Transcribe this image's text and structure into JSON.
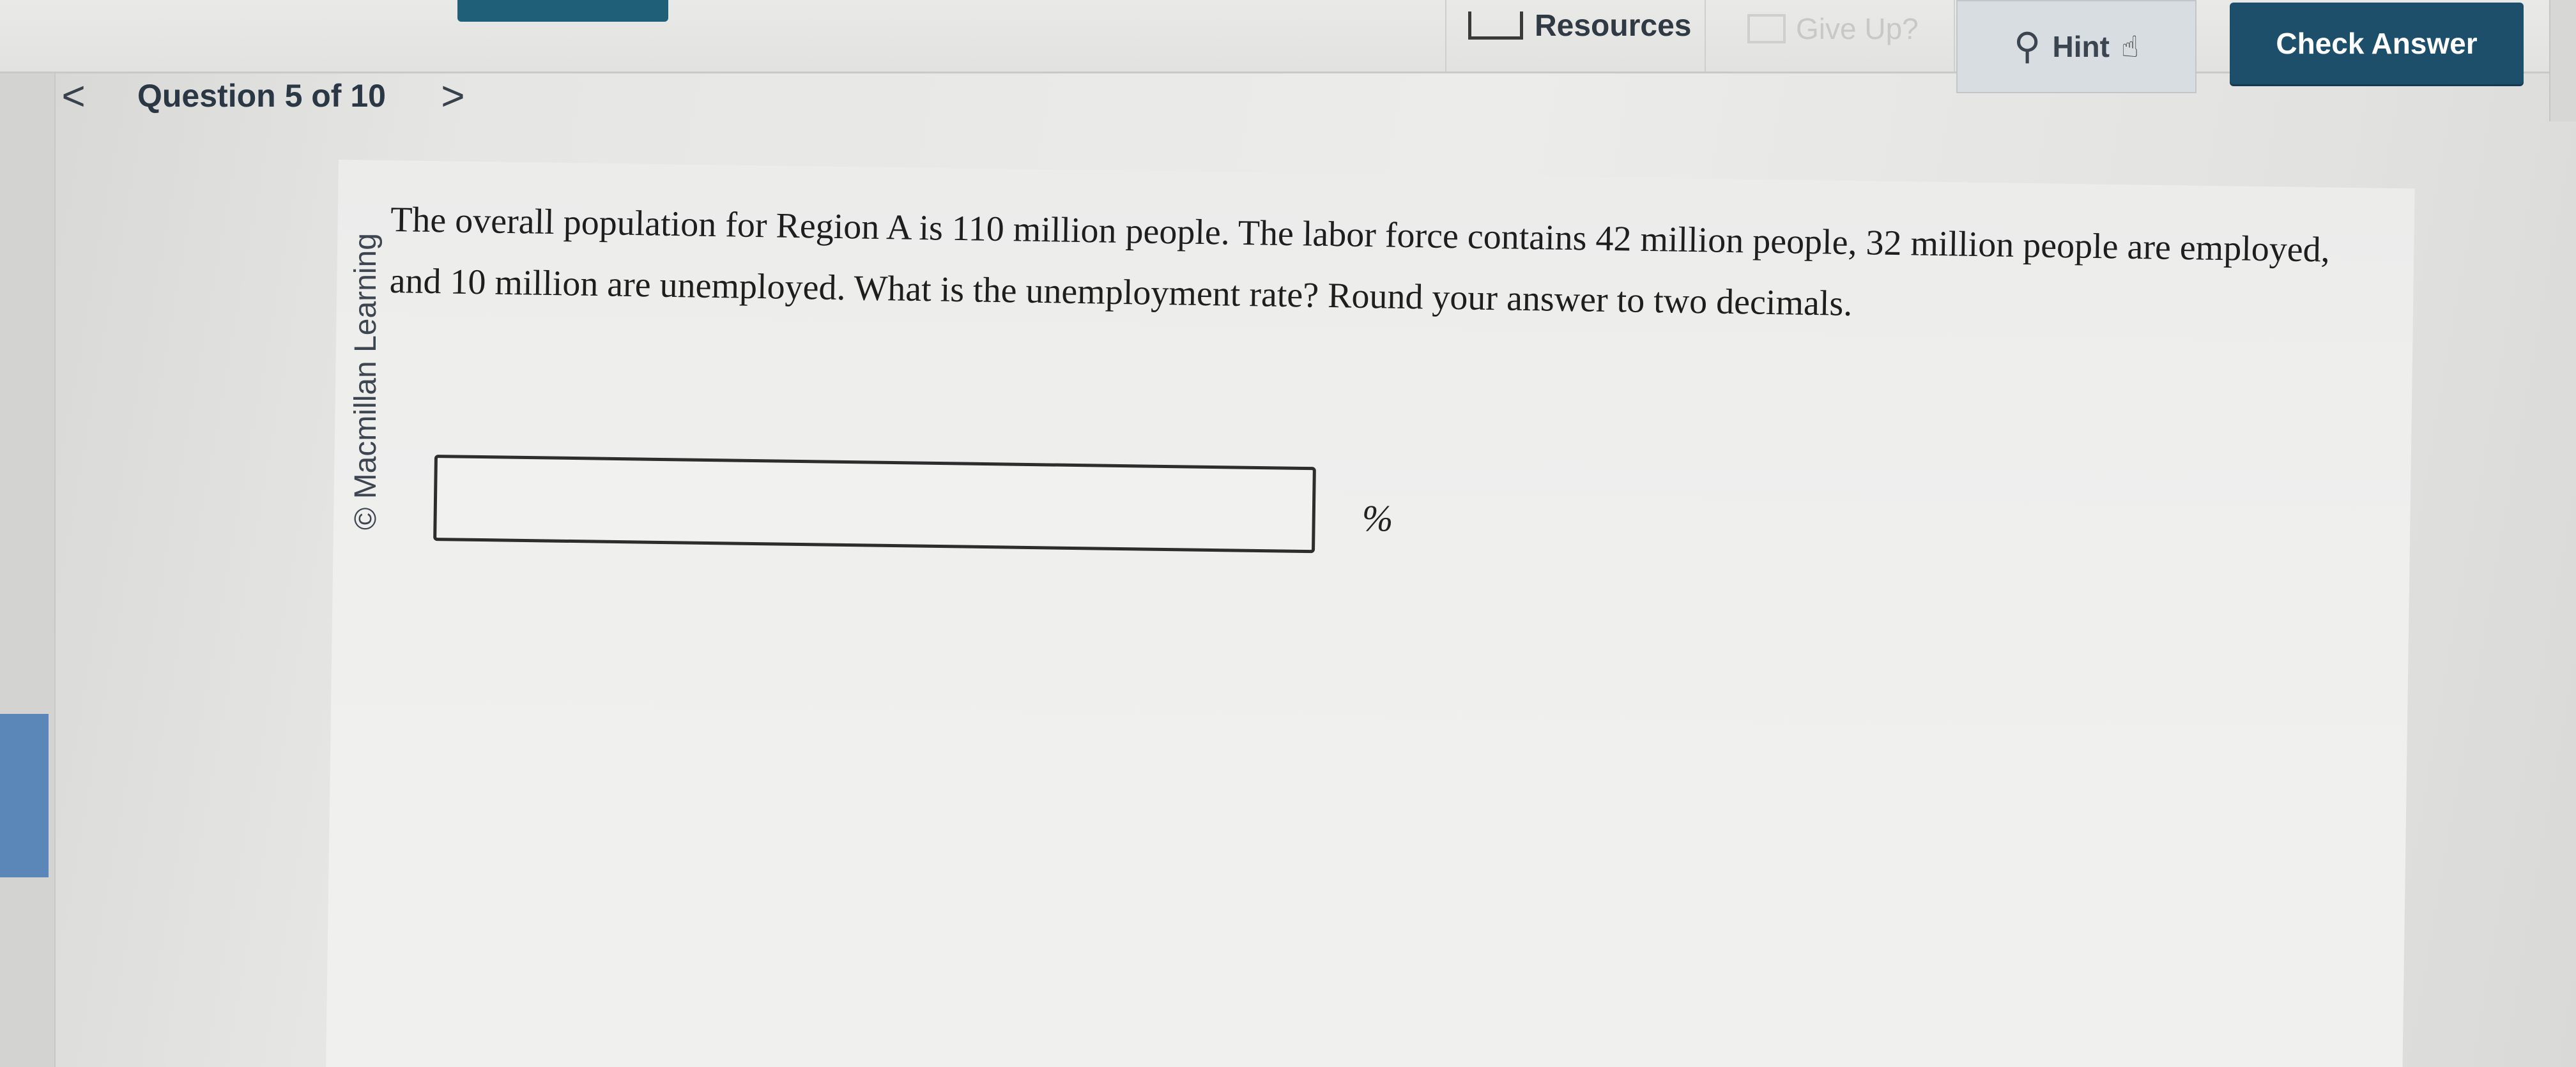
{
  "toolbar": {
    "resources_label": "Resources",
    "resources_icon": "book-icon",
    "give_up_label": "Give Up?",
    "give_up_icon": "give-up-icon",
    "hint_label": "Hint",
    "hint_icon": "lightbulb-icon",
    "check_answer_label": "Check Answer",
    "accent_color": "#1d4f6b"
  },
  "navigation": {
    "question_label": "Question 5 of 10",
    "prev_glyph": "<",
    "next_glyph": ">"
  },
  "question": {
    "copyright": "© Macmillan Learning",
    "text": "The overall population for Region A is 110 million people. The labor force contains 42 million people, 32 million people are employed, and 10 million are unemployed. What is the unemployment rate? Round your answer to two decimals.",
    "answer_value": "",
    "answer_unit": "%"
  }
}
